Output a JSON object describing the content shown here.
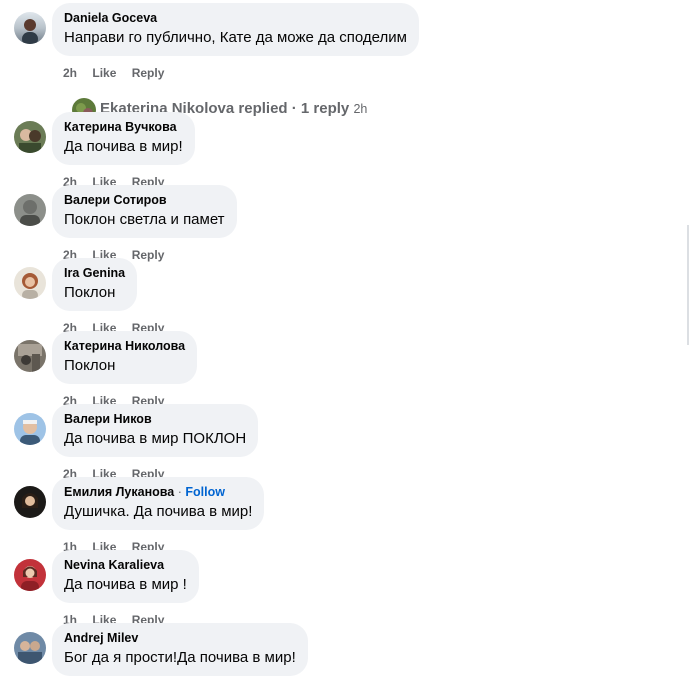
{
  "comments": [
    {
      "author": "Daniela Goceva",
      "text": "Направи го публично, Кате да може да споделим",
      "time": "2h",
      "like": "Like",
      "reply": "Reply"
    },
    {
      "author": "Катерина Вучкова",
      "text": "Да почива в мир!",
      "time": "2h",
      "like": "Like",
      "reply": "Reply"
    },
    {
      "author": "Валери Сотиров",
      "text": "Поклон светла и памет",
      "time": "2h",
      "like": "Like",
      "reply": "Reply"
    },
    {
      "author": "Ira Genina",
      "text": "Поклон",
      "time": "2h",
      "like": "Like",
      "reply": "Reply"
    },
    {
      "author": "Катерина Николова",
      "text": "Поклон",
      "time": "2h",
      "like": "Like",
      "reply": "Reply"
    },
    {
      "author": "Валери Ников",
      "text": "Да почива в мир ПОКЛОН",
      "time": "2h",
      "like": "Like",
      "reply": "Reply"
    },
    {
      "author": "Емилия Луканова",
      "follow": "Follow",
      "text": "Душичка. Да почива в мир!",
      "time": "1h",
      "like": "Like",
      "reply": "Reply"
    },
    {
      "author": "Nevina Karalieva",
      "text": "Да почива в мир !",
      "time": "1h",
      "like": "Like",
      "reply": "Reply"
    },
    {
      "author": "Andrej Milev",
      "text": "Бог да я прости!Да почива в мир!",
      "time": "",
      "like": "",
      "reply": ""
    }
  ],
  "replies_link": {
    "label": "Ekaterina Nikolova replied · 1 reply",
    "time": "2h"
  },
  "colors": {
    "bubble": "#f0f2f5",
    "meta": "#65676b",
    "follow": "#0064d1"
  }
}
